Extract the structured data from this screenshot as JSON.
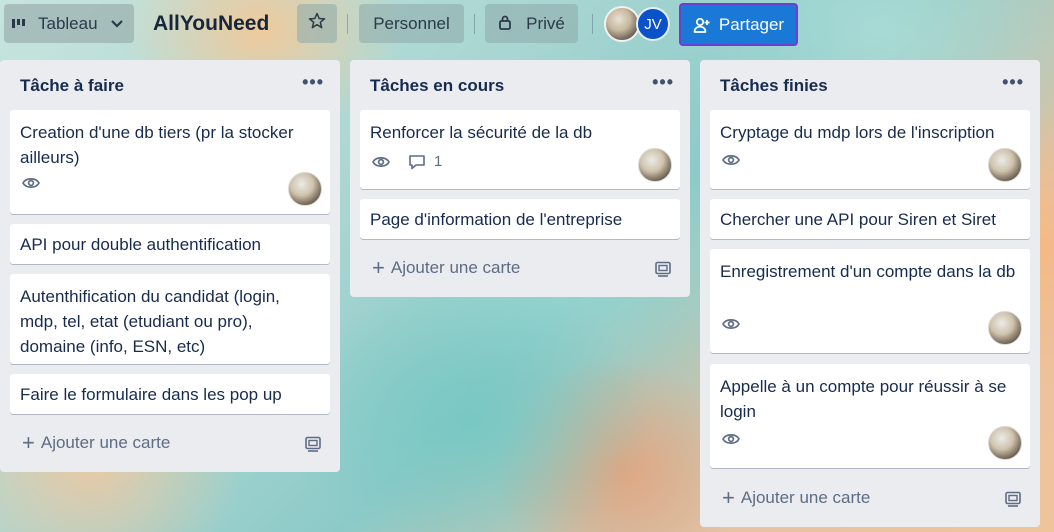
{
  "header": {
    "view_label": "Tableau",
    "view_icon": "bars-icon",
    "board_title": "AllYouNeed",
    "star_icon": "star-icon",
    "personal_label": "Personnel",
    "private_label": "Privé",
    "member_initials": "JV",
    "share_label": "Partager",
    "colors": {
      "share_bg": "#1a78d6",
      "share_border": "#6a3fd1",
      "jv_bg": "#0a52c9"
    }
  },
  "lists": [
    {
      "title": "Tâche à faire",
      "add_label": "Ajouter une carte",
      "cards": [
        {
          "title": "Creation d'une db tiers (pr la stocker ailleurs)",
          "watch": true
        },
        {
          "title": "API pour double authentification"
        },
        {
          "title": "Autenthification du candidat (login, mdp, tel, etat (etudiant ou pro), domaine (info, ESN, etc)"
        },
        {
          "title": "Faire le formulaire dans les pop up"
        }
      ]
    },
    {
      "title": "Tâches en cours",
      "add_label": "Ajouter une carte",
      "cards": [
        {
          "title": "Renforcer la sécurité de la db",
          "watch": true,
          "comments": "1"
        },
        {
          "title": "Page d'information de l'entreprise"
        }
      ]
    },
    {
      "title": "Tâches finies",
      "add_label": "Ajouter une carte",
      "cards": [
        {
          "title": "Cryptage du mdp lors de l'inscription",
          "watch": true
        },
        {
          "title": "Chercher une API pour Siren et Siret"
        },
        {
          "title": "Enregistrement d'un compte dans la db",
          "watch": true
        },
        {
          "title": "Appelle à un compte pour réussir à se login",
          "watch": true
        }
      ]
    }
  ]
}
